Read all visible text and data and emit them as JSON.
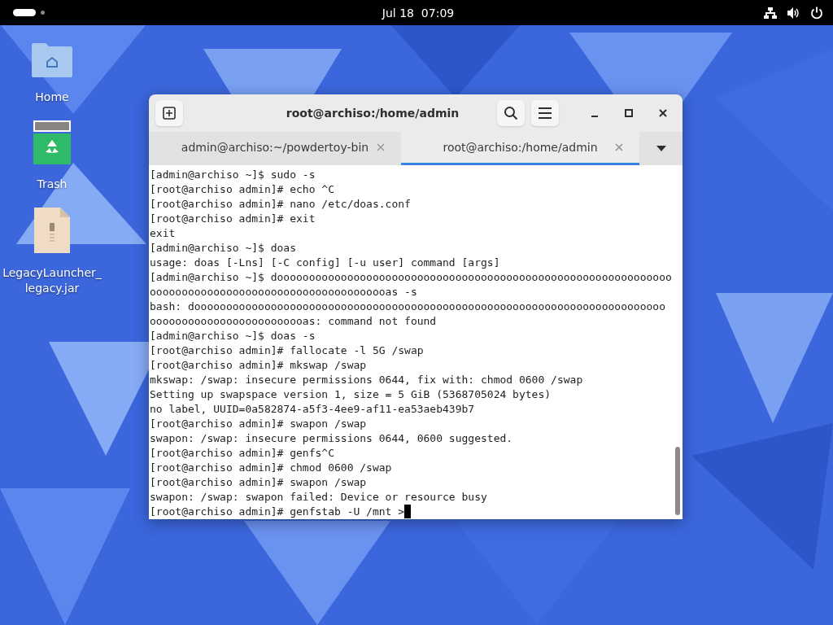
{
  "top_bar": {
    "clock": "Jul 18  07:09"
  },
  "desktop_icons": [
    {
      "kind": "folder",
      "label_lines": [
        "Home"
      ]
    },
    {
      "kind": "trash",
      "label_lines": [
        "Trash"
      ]
    },
    {
      "kind": "archive",
      "label_lines": [
        "LegacyLauncher_",
        "legacy.jar"
      ]
    }
  ],
  "window": {
    "title": "root@archiso:/home/admin",
    "tabs": [
      {
        "label": "admin@archiso:~/powdertoy-bin",
        "selected": false
      },
      {
        "label": "root@archiso:/home/admin",
        "selected": true
      }
    ],
    "terminal_lines": [
      "[admin@archiso ~]$ sudo -s",
      "[root@archiso admin]# echo ^C",
      "[root@archiso admin]# nano /etc/doas.conf",
      "[root@archiso admin]# exit",
      "exit",
      "[admin@archiso ~]$ doas",
      "usage: doas [-Lns] [-C config] [-u user] command [args]",
      "[admin@archiso ~]$ doooooooooooooooooooooooooooooooooooooooooooooooooooooooooooooo",
      "oooooooooooooooooooooooooooooooooooooas -s",
      "bash: doooooooooooooooooooooooooooooooooooooooooooooooooooooooooooooooooooooooooo",
      "ooooooooooooooooooooooooas: command not found",
      "[admin@archiso ~]$ doas -s",
      "[root@archiso admin]# fallocate -l 5G /swap",
      "[root@archiso admin]# mkswap /swap",
      "mkswap: /swap: insecure permissions 0644, fix with: chmod 0600 /swap",
      "Setting up swapspace version 1, size = 5 GiB (5368705024 bytes)",
      "no label, UUID=0a582874-a5f3-4ee9-af11-ea53aeb439b7",
      "[root@archiso admin]# swapon /swap",
      "swapon: /swap: insecure permissions 0644, 0600 suggested.",
      "[root@archiso admin]# genfs^C",
      "[root@archiso admin]# chmod 0600 /swap",
      "[root@archiso admin]# swapon /swap",
      "swapon: /swap: swapon failed: Device or resource busy",
      "[root@archiso admin]# genfstab -U /mnt >"
    ]
  }
}
